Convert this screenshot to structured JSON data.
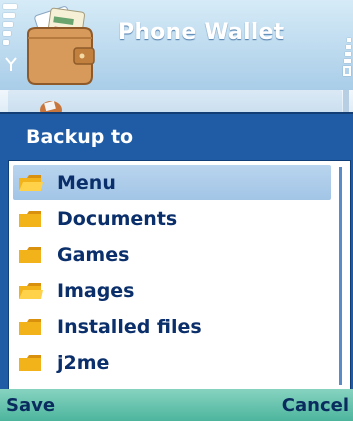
{
  "app": {
    "title": "Phone Wallet"
  },
  "dialog": {
    "title": "Backup to",
    "items": [
      {
        "label": "Menu",
        "selected": true
      },
      {
        "label": "Documents",
        "selected": false
      },
      {
        "label": "Games",
        "selected": false
      },
      {
        "label": "Images",
        "selected": false
      },
      {
        "label": "Installed files",
        "selected": false
      },
      {
        "label": "j2me",
        "selected": false
      }
    ]
  },
  "softkeys": {
    "left": "Save",
    "right": "Cancel"
  },
  "icons": {
    "app": "wallet-icon",
    "signal": "signal-strength-icon",
    "battery": "battery-icon",
    "folder": "folder-icon"
  },
  "colors": {
    "dialog_bg": "#1f5ca5",
    "selection": "#a9cae9",
    "softkey_bar": "#5cc0a8",
    "folder": "#f2b21a",
    "text_dark": "#0b2f6a"
  }
}
